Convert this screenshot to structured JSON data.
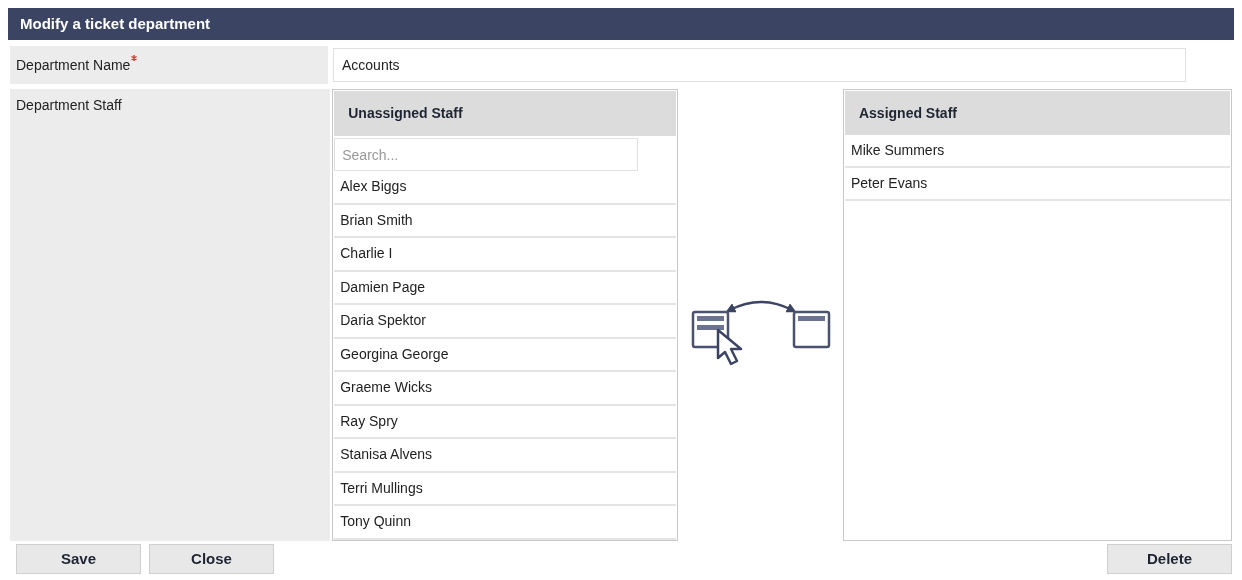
{
  "title": "Modify a ticket department",
  "name_field": {
    "label": "Department Name",
    "required": true,
    "value": "Accounts"
  },
  "staff": {
    "label": "Department Staff",
    "unassigned": {
      "title": "Unassigned Staff",
      "search_placeholder": "Search...",
      "items": [
        "Alex Biggs",
        "Brian Smith",
        "Charlie I",
        "Damien Page",
        "Daria Spektor",
        "Georgina George",
        "Graeme Wicks",
        "Ray Spry",
        "Stanisa Alvens",
        "Terri Mullings",
        "Tony Quinn"
      ]
    },
    "assigned": {
      "title": "Assigned Staff",
      "items": [
        "Mike Summers",
        "Peter Evans"
      ]
    }
  },
  "buttons": {
    "left": [
      "Save",
      "Close"
    ],
    "right": [
      "Delete"
    ]
  }
}
